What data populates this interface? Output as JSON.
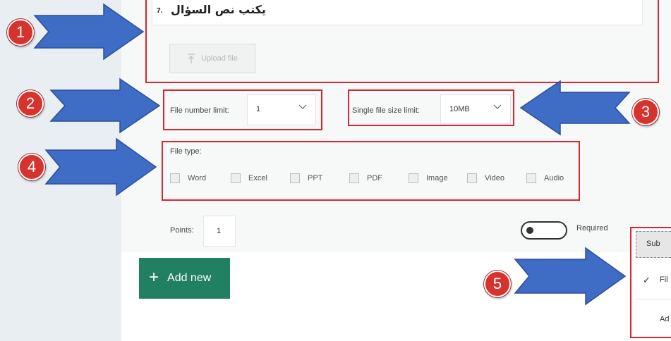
{
  "question": {
    "number": "7.",
    "text": "يكتب نص السؤال"
  },
  "upload_button": {
    "label": "Upload file",
    "icon": "upload-icon"
  },
  "file_number_limit": {
    "label": "File number limit:",
    "value": "1"
  },
  "single_file_size_limit": {
    "label": "Single file size limit:",
    "value": "10MB"
  },
  "file_type": {
    "label": "File type:",
    "options": [
      "Word",
      "Excel",
      "PPT",
      "PDF",
      "Image",
      "Video",
      "Audio"
    ]
  },
  "points": {
    "label": "Points:",
    "value": "1"
  },
  "required": {
    "label": "Required"
  },
  "add_new": {
    "label": "Add new"
  },
  "menu": {
    "items": [
      "Sub",
      "Fil",
      "Ad"
    ]
  },
  "callouts": [
    "1",
    "2",
    "3",
    "4",
    "5"
  ],
  "colors": {
    "highlight_red": "#d9262e",
    "badge_red": "#d6322e",
    "arrow_blue": "#3f6cc4",
    "add_new_green": "#217f62"
  }
}
